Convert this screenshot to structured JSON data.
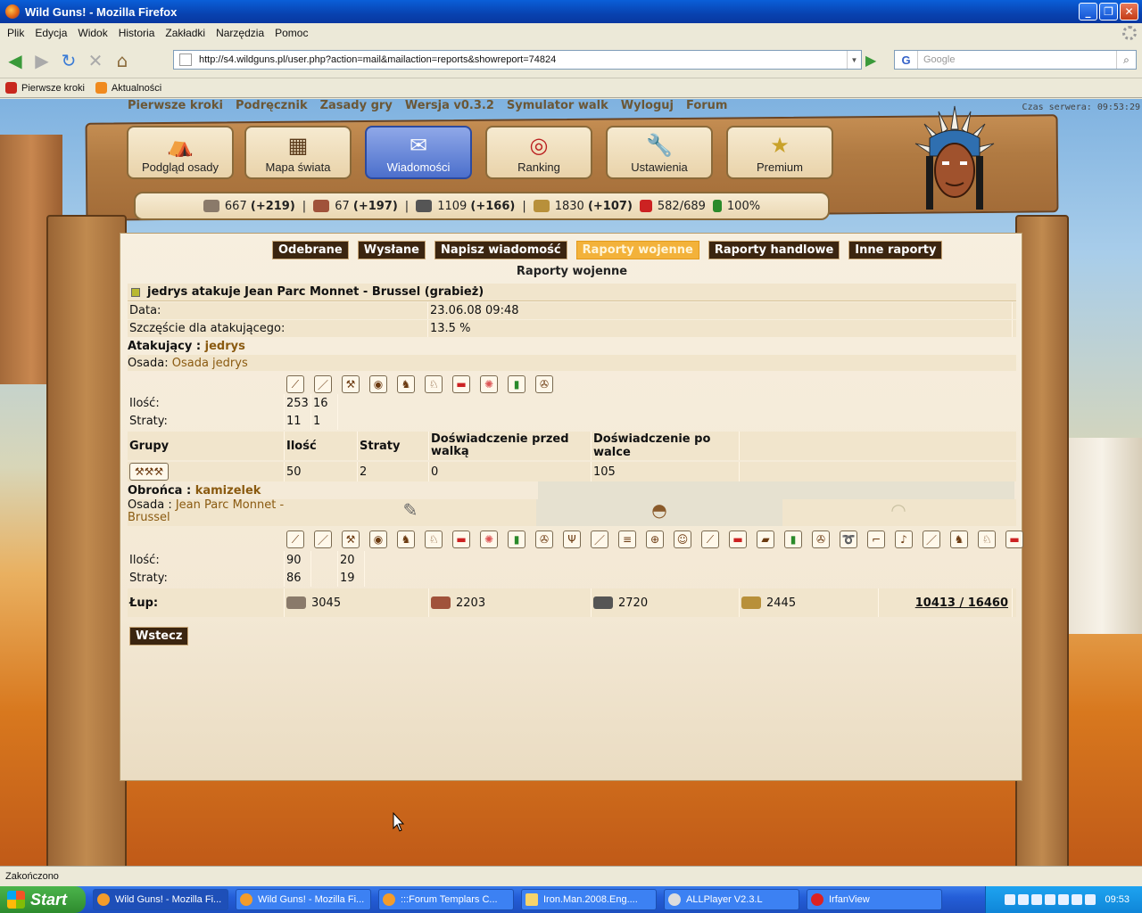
{
  "window": {
    "title": "Wild Guns! - Mozilla Firefox"
  },
  "menu": [
    "Plik",
    "Edycja",
    "Widok",
    "Historia",
    "Zakładki",
    "Narzędzia",
    "Pomoc"
  ],
  "nav": {
    "url": "http://s4.wildguns.pl/user.php?action=mail&mailaction=reports&showreport=74824",
    "search_placeholder": "Google"
  },
  "bookmarks": [
    "Pierwsze kroki",
    "Aktualności"
  ],
  "game": {
    "topnav": [
      "Pierwsze kroki",
      "Podręcznik",
      "Zasady gry",
      "Wersja v0.3.2",
      "Symulator walk",
      "Wyloguj",
      "Forum"
    ],
    "server_time": "Czas serwera: 09:53:29",
    "buttons": [
      "Podgląd osady",
      "Mapa świata",
      "Wiadomości",
      "Ranking",
      "Ustawienia",
      "Premium"
    ],
    "resources": {
      "wood": "667",
      "wood_rate": "(+219)",
      "clay": "67",
      "clay_rate": "(+197)",
      "iron": "1109",
      "iron_rate": "(+166)",
      "grain": "1830",
      "grain_rate": "(+107)",
      "pop": "582/689",
      "morale": "100%"
    },
    "tabs": [
      "Odebrane",
      "Wysłane",
      "Napisz wiadomość",
      "Raporty wojenne",
      "Raporty handlowe",
      "Inne raporty"
    ],
    "subtitle": "Raporty wojenne",
    "report": {
      "heading": "jedrys atakuje Jean Parc Monnet - Brussel (grabież)",
      "date_label": "Data:",
      "date": "23.06.08 09:48",
      "luck_label": "Szczęście dla atakującego:",
      "luck": "13.5 %",
      "attacker_label": "Atakujący :",
      "attacker": "jedrys",
      "osada_label": "Osada:",
      "attacker_village": "Osada jedrys",
      "ilosc_label": "Ilość:",
      "straty_label": "Straty:",
      "att_qty": [
        "253",
        "16"
      ],
      "att_loss": [
        "11",
        "1"
      ],
      "groups_header": [
        "Grupy",
        "Ilość",
        "Straty",
        "Doświadczenie przed walką",
        "Doświadczenie po walce"
      ],
      "group_row": [
        "50",
        "2",
        "0",
        "105"
      ],
      "defender_label": "Obrońca :",
      "defender": "kamizelek",
      "def_osada_label": "Osada :",
      "defender_village": "Jean Parc Monnet - Brussel",
      "def_qty": [
        "90",
        "",
        "20"
      ],
      "def_loss": [
        "86",
        "",
        "19"
      ],
      "loot_label": "Łup:",
      "loot": [
        "3045",
        "2203",
        "2720",
        "2445"
      ],
      "loot_total": "10413 / 16460",
      "back": "Wstecz"
    }
  },
  "status": "Zakończono",
  "taskbar": {
    "start": "Start",
    "tasks": [
      "Wild Guns! - Mozilla Fi...",
      "Wild Guns! - Mozilla Fi...",
      ":::Forum Templars C...",
      "Iron.Man.2008.Eng....",
      "ALLPlayer V2.3.L",
      "IrfanView"
    ],
    "clock": "09:53"
  }
}
